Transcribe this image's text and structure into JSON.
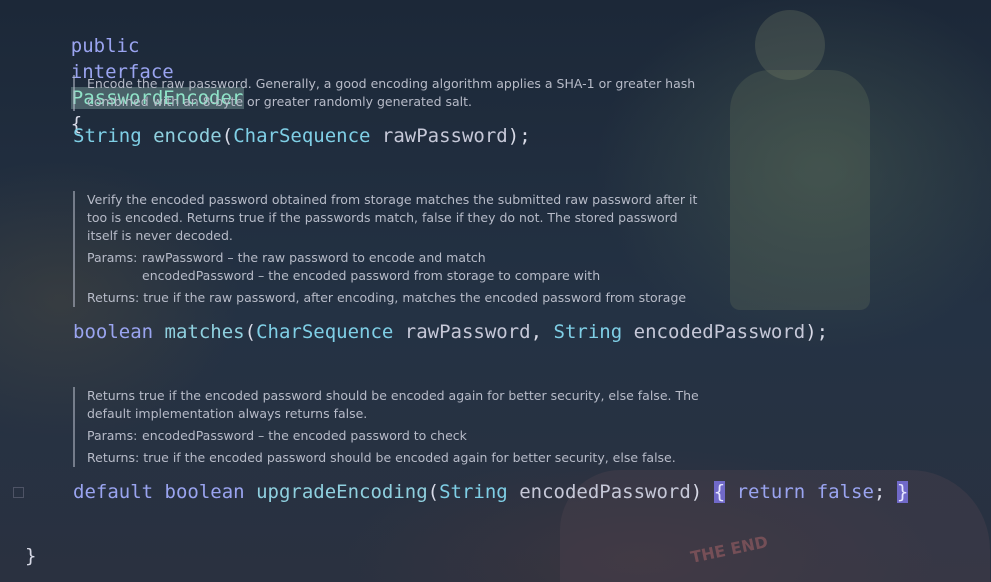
{
  "code": {
    "interface_line": {
      "modifier": "public",
      "keyword": "interface",
      "name": "PasswordEncoder",
      "open_brace": "{"
    },
    "encode": {
      "doc": "Encode the raw password. Generally, a good encoding algorithm applies a SHA-1 or greater hash combined with an 8-byte or greater randomly generated salt.",
      "return_type": "String",
      "name": "encode",
      "open_paren": "(",
      "param_type": "CharSequence",
      "param_name": "rawPassword",
      "close": ");"
    },
    "matches": {
      "doc": "Verify the encoded password obtained from storage matches the submitted raw password after it too is encoded. Returns true if the passwords match, false if they do not. The stored password itself is never decoded.",
      "params_label": "Params:",
      "params": [
        "rawPassword – the raw password to encode and match",
        "encodedPassword – the encoded password from storage to compare with"
      ],
      "returns_label": "Returns:",
      "returns": "true if the raw password, after encoding, matches the encoded password from storage",
      "return_type": "boolean",
      "name": "matches",
      "open_paren": "(",
      "param1_type": "CharSequence",
      "param1_name": "rawPassword",
      "comma": ", ",
      "param2_type": "String",
      "param2_name": "encodedPassword",
      "close": ");"
    },
    "upgrade": {
      "doc": "Returns true if the encoded password should be encoded again for better security, else false. The default implementation always returns false.",
      "params_label": "Params:",
      "params": [
        "encodedPassword – the encoded password to check"
      ],
      "returns_label": "Returns:",
      "returns": "true if the encoded password should be encoded again for better security, else false.",
      "modifier": "default",
      "return_type": "boolean",
      "name": "upgradeEncoding",
      "open_paren": "(",
      "param_type": "String",
      "param_name": "encodedPassword",
      "close_paren": ")",
      "open_brace": "{",
      "return_kw": "return",
      "return_value": "false",
      "semicolon": ";",
      "close_brace": "}"
    },
    "closing_brace": "}"
  },
  "background": {
    "caption": "THE END"
  }
}
